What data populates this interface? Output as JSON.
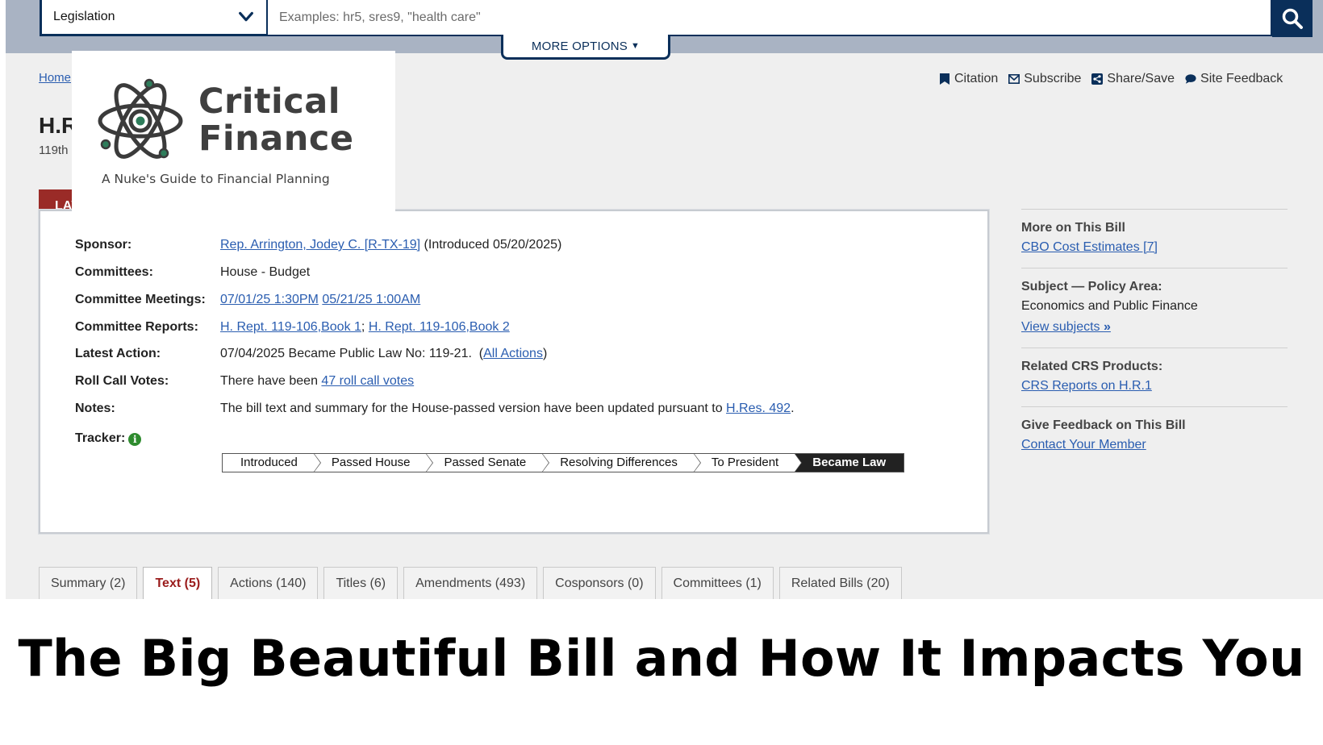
{
  "search": {
    "select_value": "Legislation",
    "placeholder": "Examples: hr5, sres9, \"health care\"",
    "more_options": "MORE OPTIONS"
  },
  "breadcrumb": {
    "home": "Home"
  },
  "bill": {
    "title": "H.R.1",
    "congress": "119th"
  },
  "toolbar": {
    "citation": "Citation",
    "subscribe": "Subscribe",
    "share": "Share/Save",
    "feedback": "Site Feedback"
  },
  "law_tab": {
    "label": "LAW"
  },
  "overview": {
    "sponsor_label": "Sponsor:",
    "sponsor_link": "Rep. Arrington, Jodey C. [R-TX-19]",
    "sponsor_intro": " (Introduced 05/20/2025)",
    "committees_label": "Committees:",
    "committees_value": "House - Budget",
    "meetings_label": "Committee Meetings:",
    "meeting_1": "07/01/25 1:30PM",
    "meeting_2": "05/21/25 1:00AM",
    "reports_label": "Committee Reports:",
    "report_1": "H. Rept. 119-106,Book 1",
    "report_sep": "; ",
    "report_2": "H. Rept. 119-106,Book 2",
    "latest_label": "Latest Action:",
    "latest_value": "07/04/2025 Became Public Law No: 119-21.  (",
    "all_actions": "All Actions",
    "latest_close": ")",
    "rollcall_label": "Roll Call Votes:",
    "rollcall_prefix": "There have been ",
    "rollcall_link": "47 roll call votes",
    "notes_label": "Notes:",
    "notes_prefix": "The bill text and summary for the House-passed version have been updated pursuant to ",
    "notes_link": "H.Res. 492",
    "notes_suffix": ".",
    "tracker_label": "Tracker:",
    "tracker_info": "i",
    "tracker_steps": [
      "Introduced",
      "Passed House",
      "Passed Senate",
      "Resolving Differences",
      "To President",
      "Became Law"
    ]
  },
  "sidebar": {
    "more_h": "More on This Bill",
    "cbo": "CBO Cost Estimates [7]",
    "subject_h": "Subject — Policy Area:",
    "subject_t": "Economics and Public Finance",
    "view_subjects": "View subjects",
    "crs_h": "Related CRS Products:",
    "crs": "CRS Reports on H.R.1",
    "feedback_h": "Give Feedback on This Bill",
    "contact": "Contact Your Member"
  },
  "tabs": [
    "Summary (2)",
    "Text (5)",
    "Actions (140)",
    "Titles (6)",
    "Amendments (493)",
    "Cosponsors (0)",
    "Committees (1)",
    "Related Bills (20)"
  ],
  "logo": {
    "line1": "Critical",
    "line2": "Finance",
    "tagline": "A Nuke's Guide to Financial Planning"
  },
  "headline": "The Big Beautiful Bill and How It Impacts You",
  "colors": {
    "navy": "#0a2f5a",
    "law_red": "#9a2b27",
    "link_blue": "#2a5db0",
    "logo_teal": "#2e7d5b"
  }
}
